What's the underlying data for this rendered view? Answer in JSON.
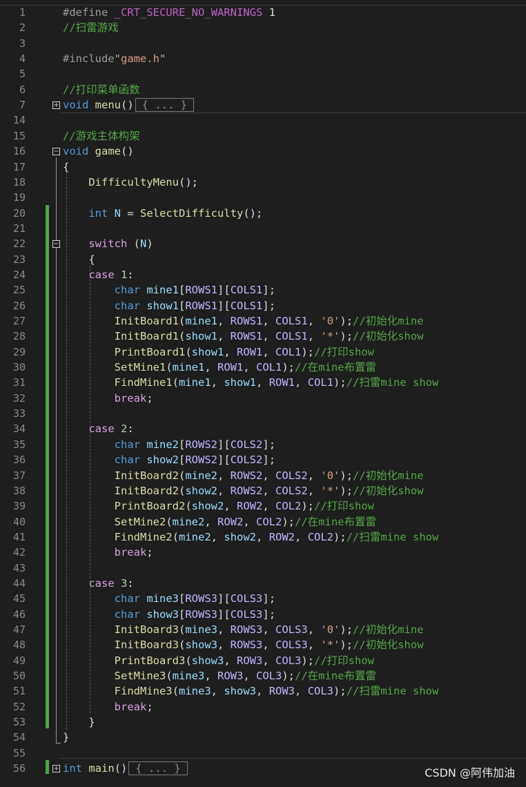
{
  "editor": {
    "lines": [
      {
        "n": "1",
        "html": "<span class='pp'>#define </span><span class='macro'>_CRT_SECURE_NO_WARNINGS</span> 1"
      },
      {
        "n": "2",
        "html": "<span class='cm'>//扫雷游戏</span>"
      },
      {
        "n": "3",
        "html": ""
      },
      {
        "n": "4",
        "html": "<span class='pp'>#include</span><span class='str'>\"game.h\"</span>"
      },
      {
        "n": "5",
        "html": ""
      },
      {
        "n": "6",
        "html": "<span class='cm'>//打印菜单函数</span>"
      },
      {
        "n": "7",
        "html": "<span class='kw'>void</span> <span class='fn'>menu</span>()<span class='collapsed'>{ ... }</span>",
        "fold": "+"
      },
      {
        "n": "14",
        "html": ""
      },
      {
        "n": "15",
        "html": "<span class='cm'>//游戏主体构架</span>"
      },
      {
        "n": "16",
        "html": "<span class='kw'>void</span> <span class='fn'>game</span>()",
        "fold": "−"
      },
      {
        "n": "17",
        "html": "{"
      },
      {
        "n": "18",
        "html": "    <span class='fn'>DifficultyMenu</span>();"
      },
      {
        "n": "19",
        "html": ""
      },
      {
        "n": "20",
        "html": "    <span class='kw'>int</span> <span class='var'>N</span> = <span class='fn'>SelectDifficulty</span>();"
      },
      {
        "n": "21",
        "html": ""
      },
      {
        "n": "22",
        "html": "    <span class='kw2'>switch</span> (<span class='var'>N</span>)",
        "fold": "−"
      },
      {
        "n": "23",
        "html": "    {"
      },
      {
        "n": "24",
        "html": "    <span class='kw2'>case</span> <span class='num'>1</span>:"
      },
      {
        "n": "25",
        "html": "        <span class='kw'>char</span> <span class='var'>mine1</span>[<span class='mac2'>ROWS1</span>][<span class='mac2'>COLS1</span>];"
      },
      {
        "n": "26",
        "html": "        <span class='kw'>char</span> <span class='var'>show1</span>[<span class='mac2'>ROWS1</span>][<span class='mac2'>COLS1</span>];"
      },
      {
        "n": "27",
        "html": "        <span class='fn'>InitBoard1</span>(<span class='var'>mine1</span>, <span class='mac2'>ROWS1</span>, <span class='mac2'>COLS1</span>, <span class='str'>'0'</span>);<span class='cm'>//初始化mine</span>"
      },
      {
        "n": "28",
        "html": "        <span class='fn'>InitBoard1</span>(<span class='var'>show1</span>, <span class='mac2'>ROWS1</span>, <span class='mac2'>COLS1</span>, <span class='str'>'*'</span>);<span class='cm'>//初始化show</span>"
      },
      {
        "n": "29",
        "html": "        <span class='fn'>PrintBoard1</span>(<span class='var'>show1</span>, <span class='mac2'>ROW1</span>, <span class='mac2'>COL1</span>);<span class='cm'>//打印show</span>"
      },
      {
        "n": "30",
        "html": "        <span class='fn'>SetMine1</span>(<span class='var'>mine1</span>, <span class='mac2'>ROW1</span>, <span class='mac2'>COL1</span>);<span class='cm'>//在mine布置雷</span>"
      },
      {
        "n": "31",
        "html": "        <span class='fn'>FindMine1</span>(<span class='var'>mine1</span>, <span class='var'>show1</span>, <span class='mac2'>ROW1</span>, <span class='mac2'>COL1</span>);<span class='cm'>//扫雷mine show</span>"
      },
      {
        "n": "32",
        "html": "        <span class='kw2'>break</span>;"
      },
      {
        "n": "33",
        "html": ""
      },
      {
        "n": "34",
        "html": "    <span class='kw2'>case</span> <span class='num'>2</span>:"
      },
      {
        "n": "35",
        "html": "        <span class='kw'>char</span> <span class='var'>mine2</span>[<span class='mac2'>ROWS2</span>][<span class='mac2'>COLS2</span>];"
      },
      {
        "n": "36",
        "html": "        <span class='kw'>char</span> <span class='var'>show2</span>[<span class='mac2'>ROWS2</span>][<span class='mac2'>COLS2</span>];"
      },
      {
        "n": "37",
        "html": "        <span class='fn'>InitBoard2</span>(<span class='var'>mine2</span>, <span class='mac2'>ROWS2</span>, <span class='mac2'>COLS2</span>, <span class='str'>'0'</span>);<span class='cm'>//初始化mine</span>"
      },
      {
        "n": "38",
        "html": "        <span class='fn'>InitBoard2</span>(<span class='var'>show2</span>, <span class='mac2'>ROWS2</span>, <span class='mac2'>COLS2</span>, <span class='str'>'*'</span>);<span class='cm'>//初始化show</span>"
      },
      {
        "n": "39",
        "html": "        <span class='fn'>PrintBoard2</span>(<span class='var'>show2</span>, <span class='mac2'>ROW2</span>, <span class='mac2'>COL2</span>);<span class='cm'>//打印show</span>"
      },
      {
        "n": "40",
        "html": "        <span class='fn'>SetMine2</span>(<span class='var'>mine2</span>, <span class='mac2'>ROW2</span>, <span class='mac2'>COL2</span>);<span class='cm'>//在mine布置雷</span>"
      },
      {
        "n": "41",
        "html": "        <span class='fn'>FindMine2</span>(<span class='var'>mine2</span>, <span class='var'>show2</span>, <span class='mac2'>ROW2</span>, <span class='mac2'>COL2</span>);<span class='cm'>//扫雷mine show</span>"
      },
      {
        "n": "42",
        "html": "        <span class='kw2'>break</span>;"
      },
      {
        "n": "43",
        "html": ""
      },
      {
        "n": "44",
        "html": "    <span class='kw2'>case</span> <span class='num'>3</span>:"
      },
      {
        "n": "45",
        "html": "        <span class='kw'>char</span> <span class='var'>mine3</span>[<span class='mac2'>ROWS3</span>][<span class='mac2'>COLS3</span>];"
      },
      {
        "n": "46",
        "html": "        <span class='kw'>char</span> <span class='var'>show3</span>[<span class='mac2'>ROWS3</span>][<span class='mac2'>COLS3</span>];"
      },
      {
        "n": "47",
        "html": "        <span class='fn'>InitBoard3</span>(<span class='var'>mine3</span>, <span class='mac2'>ROWS3</span>, <span class='mac2'>COLS3</span>, <span class='str'>'0'</span>);<span class='cm'>//初始化mine</span>"
      },
      {
        "n": "48",
        "html": "        <span class='fn'>InitBoard3</span>(<span class='var'>show3</span>, <span class='mac2'>ROWS3</span>, <span class='mac2'>COLS3</span>, <span class='str'>'*'</span>);<span class='cm'>//初始化show</span>"
      },
      {
        "n": "49",
        "html": "        <span class='fn'>PrintBoard3</span>(<span class='var'>show3</span>, <span class='mac2'>ROW3</span>, <span class='mac2'>COL3</span>);<span class='cm'>//打印show</span>"
      },
      {
        "n": "50",
        "html": "        <span class='fn'>SetMine3</span>(<span class='var'>mine3</span>, <span class='mac2'>ROW3</span>, <span class='mac2'>COL3</span>);<span class='cm'>//在mine布置雷</span>"
      },
      {
        "n": "51",
        "html": "        <span class='fn'>FindMine3</span>(<span class='var'>mine3</span>, <span class='var'>show3</span>, <span class='mac2'>ROW3</span>, <span class='mac2'>COL3</span>);<span class='cm'>//扫雷mine show</span>"
      },
      {
        "n": "52",
        "html": "        <span class='kw2'>break</span>;"
      },
      {
        "n": "53",
        "html": "    }"
      },
      {
        "n": "54",
        "html": "}"
      },
      {
        "n": "55",
        "html": ""
      },
      {
        "n": "56",
        "html": "<span class='kw'>int</span> <span class='fn'>main</span>()<span class='collapsed'>{ ... }</span>",
        "fold": "+"
      }
    ]
  },
  "watermark": "CSDN @阿伟加油"
}
